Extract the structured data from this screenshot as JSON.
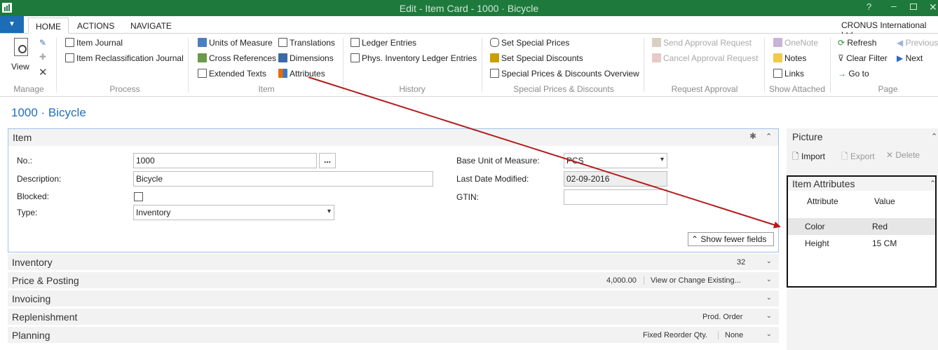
{
  "window": {
    "title": "Edit - Item Card - 1000 · Bicycle"
  },
  "tabs": [
    {
      "label": "HOME"
    },
    {
      "label": "ACTIONS"
    },
    {
      "label": "NAVIGATE"
    }
  ],
  "company": "CRONUS International Ltd",
  "ribbon": {
    "manage": {
      "view": "View",
      "group": "Manage"
    },
    "process": {
      "items": [
        "Item Journal",
        "Item Reclassification Journal"
      ],
      "group": "Process"
    },
    "item": {
      "items": [
        "Units of Measure",
        "Cross References",
        "Extended Texts",
        "Translations",
        "Dimensions",
        "Attributes"
      ],
      "group": "Item"
    },
    "history": {
      "items": [
        "Ledger Entries",
        "Phys. Inventory Ledger Entries"
      ],
      "group": "History"
    },
    "special": {
      "items": [
        "Set Special Prices",
        "Set Special Discounts",
        "Special Prices & Discounts Overview"
      ],
      "group": "Special Prices & Discounts"
    },
    "approval": {
      "items": [
        "Send Approval Request",
        "Cancel Approval Request"
      ],
      "group": "Request Approval"
    },
    "attached": {
      "items": [
        "OneNote",
        "Notes",
        "Links"
      ],
      "group": "Show Attached"
    },
    "page": {
      "items": [
        "Refresh",
        "Clear Filter",
        "Go to",
        "Previous",
        "Next"
      ],
      "group": "Page"
    }
  },
  "page_title": "1000 · Bicycle",
  "item_section": {
    "title": "Item",
    "no_label": "No.:",
    "no_value": "1000",
    "lookup": "...",
    "desc_label": "Description:",
    "desc_value": "Bicycle",
    "blocked_label": "Blocked:",
    "type_label": "Type:",
    "type_value": "Inventory",
    "base_uom_label": "Base Unit of Measure:",
    "base_uom_value": "PCS",
    "last_mod_label": "Last Date Modified:",
    "last_mod_value": "02-09-2016",
    "gtin_label": "GTIN:",
    "gtin_value": "",
    "show_fewer": "Show fewer fields"
  },
  "fasttabs": [
    {
      "title": "Inventory",
      "value": "32"
    },
    {
      "title": "Price & Posting",
      "value": "4,000.00",
      "value2": "View or Change Existing..."
    },
    {
      "title": "Invoicing",
      "value": ""
    },
    {
      "title": "Replenishment",
      "value": "Prod. Order"
    },
    {
      "title": "Planning",
      "value": "Fixed Reorder Qty.",
      "value2": "None"
    }
  ],
  "picture": {
    "title": "Picture",
    "import": "Import",
    "export": "Export",
    "delete": "Delete"
  },
  "attributes": {
    "title": "Item Attributes",
    "col_attr": "Attribute",
    "col_value": "Value",
    "rows": [
      {
        "attribute": "Color",
        "value": "Red"
      },
      {
        "attribute": "Height",
        "value": "15 CM"
      }
    ]
  },
  "colors": {
    "titlebar": "#1e7a3c",
    "accent": "#1c6cb6",
    "arrow": "#b31b1b"
  }
}
